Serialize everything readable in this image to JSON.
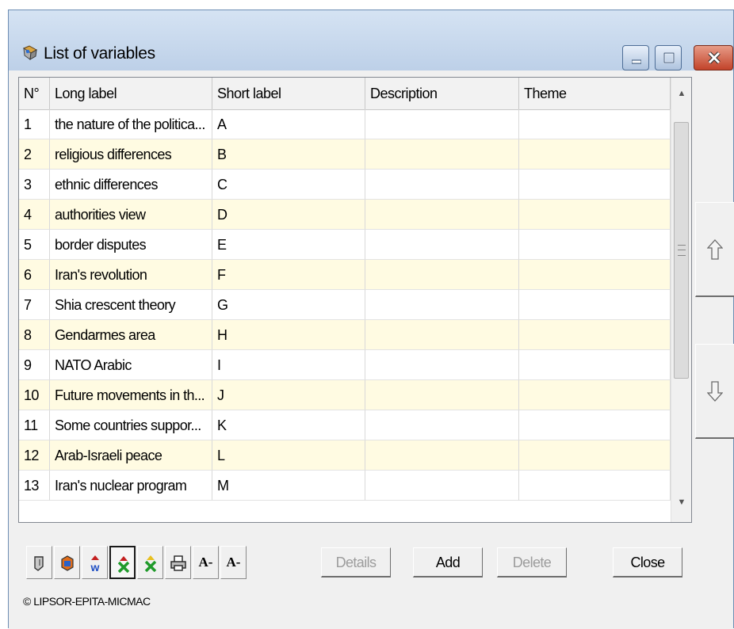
{
  "window": {
    "title": "List of variables",
    "title_icon": "app-icon",
    "controls": [
      "minimize-icon",
      "maximize-icon",
      "close-icon"
    ]
  },
  "table": {
    "columns": [
      "N°",
      "Long label",
      "Short label",
      "Description",
      "Theme"
    ],
    "rows": [
      {
        "n": "1",
        "long": "the nature of the politica...",
        "short": "A",
        "desc": "",
        "theme": ""
      },
      {
        "n": "2",
        "long": "religious differences",
        "short": "B",
        "desc": "",
        "theme": ""
      },
      {
        "n": "3",
        "long": "ethnic differences",
        "short": "C",
        "desc": "",
        "theme": ""
      },
      {
        "n": "4",
        "long": "authorities view",
        "short": "D",
        "desc": "",
        "theme": ""
      },
      {
        "n": "5",
        "long": "border disputes",
        "short": "E",
        "desc": "",
        "theme": ""
      },
      {
        "n": "6",
        "long": "Iran's revolution",
        "short": "F",
        "desc": "",
        "theme": ""
      },
      {
        "n": "7",
        "long": "Shia crescent theory",
        "short": "G",
        "desc": "",
        "theme": ""
      },
      {
        "n": "8",
        "long": "Gendarmes area",
        "short": "H",
        "desc": "",
        "theme": ""
      },
      {
        "n": "9",
        "long": "NATO Arabic",
        "short": "I",
        "desc": "",
        "theme": ""
      },
      {
        "n": "10",
        "long": "Future movements in th...",
        "short": "J",
        "desc": "",
        "theme": ""
      },
      {
        "n": "11",
        "long": "Some countries suppor...",
        "short": "K",
        "desc": "",
        "theme": ""
      },
      {
        "n": "12",
        "long": "Arab-Israeli peace",
        "short": "L",
        "desc": "",
        "theme": ""
      },
      {
        "n": "13",
        "long": "Iran's nuclear program",
        "short": "M",
        "desc": "",
        "theme": ""
      }
    ],
    "alt_row_color": "#fffbe2"
  },
  "toolbar": {
    "icons": [
      "tool-icon",
      "refresh-icon",
      "add-variable-icon",
      "remove-variable-icon",
      "delete-variable-icon",
      "print-icon"
    ],
    "font_decrease_1": "A-",
    "font_decrease_2": "A-"
  },
  "buttons": {
    "details": "Details",
    "add": "Add",
    "delete": "Delete",
    "close": "Close"
  },
  "side_buttons": [
    "move-up-icon",
    "move-down-icon"
  ],
  "footer": {
    "copyright": "© LIPSOR-EPITA-MICMAC"
  }
}
